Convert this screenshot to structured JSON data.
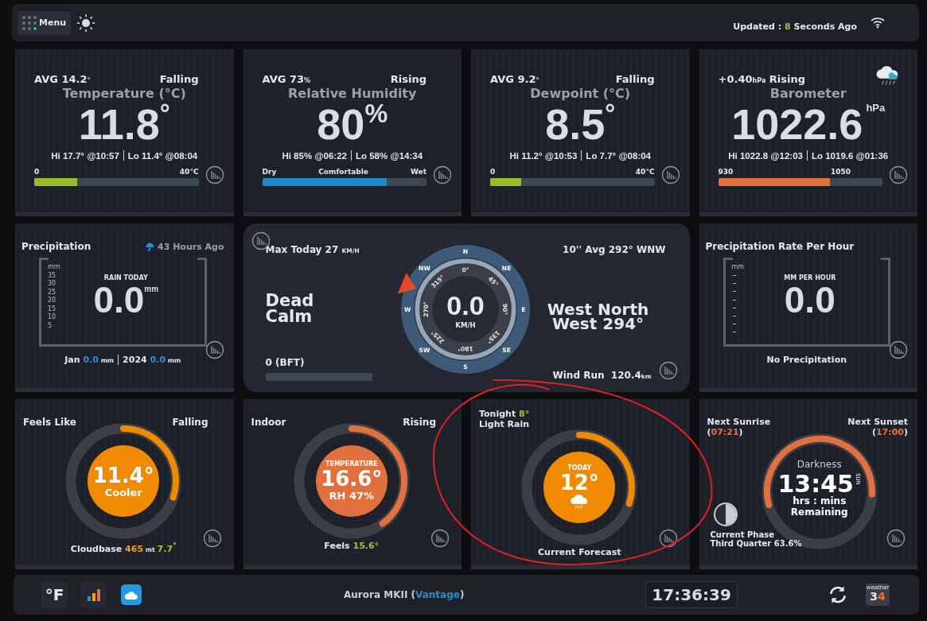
{
  "header": {
    "menu": "Menu",
    "updated": [
      {
        "text": "Updated : "
      },
      {
        "text": "8",
        "color": "#9cc23a"
      },
      {
        "text": " Seconds Ago"
      }
    ]
  },
  "top_cards": [
    {
      "kind": "temperature",
      "avg": "AVG 14.2",
      "avg_unit": "°",
      "trend": "Falling",
      "title": "Temperature (°C)",
      "value": "11.8",
      "unit": "°",
      "hi": "Hi 17.7° @10:57",
      "lo": "Lo 11.4° @08:04",
      "scale": [
        "0",
        "40°C"
      ],
      "level": 0.26,
      "color": "#97bd2a"
    },
    {
      "kind": "humidity",
      "avg": "AVG 73",
      "avg_unit": "%",
      "trend": "Rising",
      "title": "Relative Humidity",
      "value": "80",
      "unit": "%",
      "hi": "Hi 85% @06:22",
      "lo": "Lo 58% @14:34",
      "scale": [
        "Dry",
        "Comfortable",
        "Wet"
      ],
      "level": 0.76,
      "color": "#1f86c8"
    },
    {
      "kind": "temperature",
      "avg": "AVG 9.2",
      "avg_unit": "°",
      "trend": "Falling",
      "title": "Dewpoint (°C)",
      "value": "8.5",
      "unit": "°",
      "hi": "Hi 11.2° @10:53",
      "lo": "Lo 7.7° @08:04",
      "scale": [
        "0",
        "40°C"
      ],
      "level": 0.19,
      "color": "#97bd2a"
    },
    {
      "kind": "barometer",
      "avg": "+0.40",
      "avg_unit": "hPa",
      "trend": "Rising",
      "title": "Barometer",
      "value": "1022.6",
      "unit": "hPa",
      "hi": "Hi 1022.8 @12:03",
      "lo": "Lo 1019.6 @01:36",
      "scale": [
        "930",
        "1050"
      ],
      "level": 0.68,
      "color": "#e2703a"
    }
  ],
  "precipitation": {
    "title": "Precipitation",
    "ago": "43 Hours Ago",
    "axis": [
      "mm",
      "35",
      "30",
      "25",
      "20",
      "15",
      "10",
      "5"
    ],
    "caption": "RAIN TODAY",
    "value": "0.0",
    "unit": "mm",
    "totals": [
      [
        {
          "text": "Jan "
        },
        {
          "text": "0.0",
          "color": "#2a8fd0"
        },
        {
          "text": " mm",
          "small": true
        }
      ],
      [
        {
          "text": "2024 "
        },
        {
          "text": "0.0",
          "color": "#2a8fd0"
        },
        {
          "text": " mm",
          "small": true
        }
      ]
    ]
  },
  "wind": {
    "max": "Max Today 27",
    "max_unit": "KM/H",
    "calm": "Dead Calm",
    "bft": "0 (BFT)",
    "avg": "10'' Avg 292° WNW",
    "direction": "West North West 294°",
    "run_label": "Wind Run",
    "run_value": "120.4",
    "run_unit": "km",
    "compass": {
      "points": [
        "N",
        "NE",
        "E",
        "SE",
        "S",
        "SW",
        "W",
        "NW"
      ],
      "degrees": [
        "0°",
        "45°",
        "90°",
        "135°",
        "180°",
        "225°",
        "270°",
        "315°"
      ],
      "speed": "0.0",
      "speed_unit": "KM/H",
      "pointer": {
        "kind": "wnw"
      }
    }
  },
  "rate": {
    "title": "Precipitation Rate Per Hour",
    "axis_unit": "mm",
    "caption": "MM PER HOUR",
    "value": "0.0",
    "status": "No Precipitation"
  },
  "gauges": [
    {
      "kind": "feels",
      "left": [
        [
          {
            "text": "Feels Like"
          }
        ]
      ],
      "right": [
        [
          {
            "text": "Falling"
          }
        ]
      ],
      "level": 0.3,
      "color": "#f08a00",
      "value": "11.4°",
      "detail": "Cooler",
      "footer": [
        {
          "text": "Cloudbase "
        },
        {
          "text": "465",
          "color": "#f0a020"
        },
        {
          "text": " mt ",
          "small": true
        },
        {
          "text": "7.7",
          "color": "#a3c23a"
        },
        {
          "text": "$^{°}$"
        }
      ]
    },
    {
      "kind": "indoor",
      "left": [
        [
          {
            "text": "Indoor"
          }
        ]
      ],
      "right": [
        [
          {
            "text": "Rising"
          }
        ]
      ],
      "level": 0.4,
      "color": "#e0703e",
      "caption": "TEMPERATURE",
      "value": "16.6°",
      "detail": "RH 47%",
      "footer": [
        {
          "text": "Feels "
        },
        {
          "text": "15.6°",
          "color": "#a3c23a"
        }
      ]
    },
    {
      "kind": "forecast",
      "left": [
        [
          {
            "text": "Tonight "
          },
          {
            "text": "8°",
            "color": "#a3c23a"
          }
        ],
        [
          {
            "text": "Light Rain"
          }
        ]
      ],
      "level": 0.3,
      "color": "#f08a00",
      "caption": "TODAY",
      "value": "12°",
      "footer": [
        {
          "text": "Current Forecast"
        }
      ]
    },
    {
      "kind": "sun",
      "left": [
        [
          {
            "text": "Next Sunrise"
          }
        ],
        [
          {
            "text": "("
          },
          {
            "text": "07:21",
            "color": "#e8703a"
          },
          {
            "text": ")"
          }
        ]
      ],
      "right": [
        [
          {
            "text": "Next Sunset"
          }
        ],
        [
          {
            "text": "("
          },
          {
            "text": "17:00",
            "color": "#e8703a"
          },
          {
            "text": ")"
          }
        ]
      ],
      "level": 0.55,
      "color": "#e0703e",
      "caption": "Darkness",
      "value": "13:45",
      "side": "SUN",
      "detail": "hrs : mins",
      "note": "Remaining",
      "phase_label": "Current Phase",
      "phase": "Third Quarter 63.6%"
    }
  ],
  "footer": {
    "units": "°F",
    "station": [
      {
        "text": "Aurora MKII ("
      },
      {
        "text": "Vantage",
        "color": "#2a8fd0"
      },
      {
        "text": ")"
      }
    ],
    "clock": "17:36:39",
    "logo_word": "weather",
    "logo_number": [
      {
        "text": "3"
      },
      {
        "text": "4",
        "color": "#f07030"
      }
    ]
  },
  "annotation": true
}
